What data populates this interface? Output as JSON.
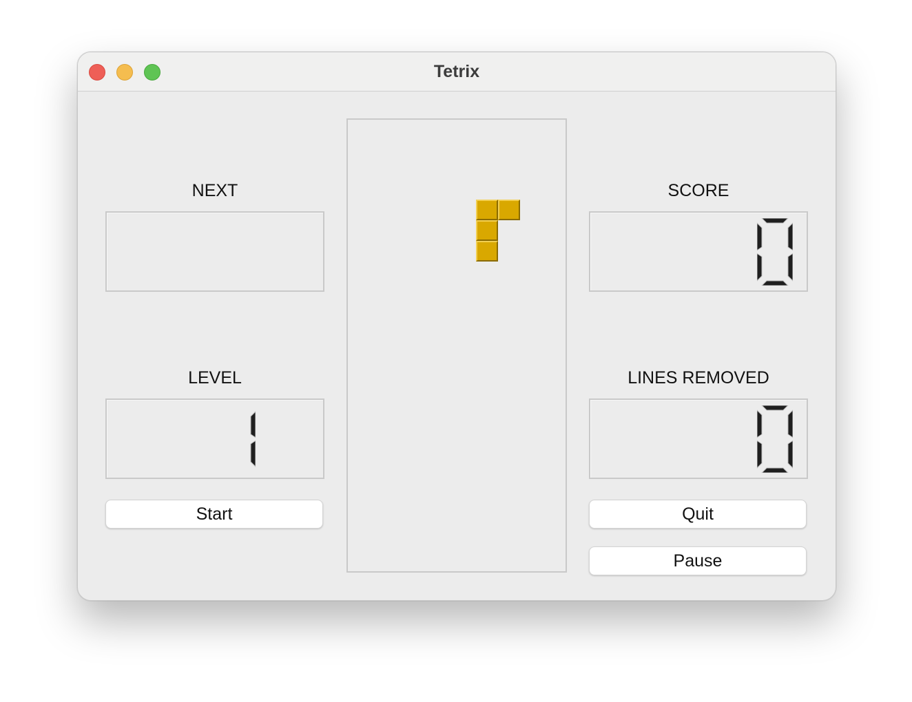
{
  "window": {
    "title": "Tetrix"
  },
  "left_panel": {
    "next_label": "NEXT",
    "level_label": "LEVEL",
    "level_value": "1",
    "start_button": "Start"
  },
  "right_panel": {
    "score_label": "SCORE",
    "score_value": "0",
    "lines_label": "LINES REMOVED",
    "lines_value": "0",
    "quit_button": "Quit",
    "pause_button": "Pause"
  },
  "board": {
    "piece_color": "#d9a800",
    "piece_cells": [
      [
        0,
        0
      ],
      [
        1,
        0
      ],
      [
        0,
        1
      ],
      [
        0,
        2
      ]
    ]
  }
}
